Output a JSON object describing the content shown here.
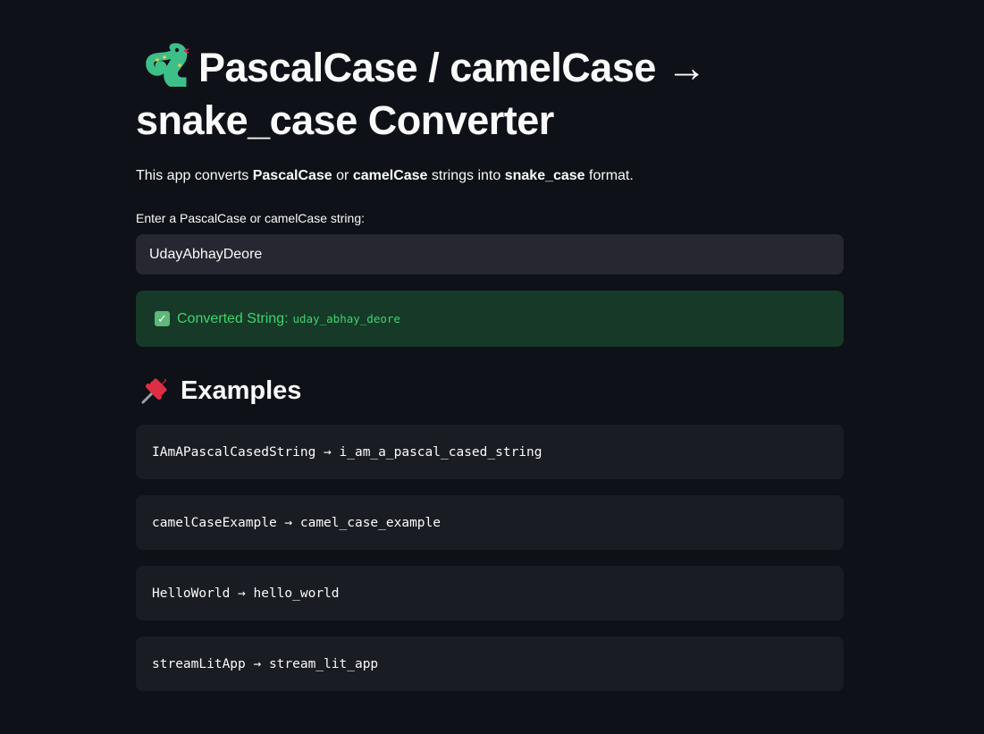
{
  "page": {
    "title_text": "PascalCase / camelCase → snake_case Converter",
    "title_icon": "snake-icon"
  },
  "intro": {
    "prefix": "This app converts ",
    "bold1": "PascalCase",
    "or": " or ",
    "bold2": "camelCase",
    "middle": " strings into ",
    "bold3": "snake_case",
    "suffix": " format."
  },
  "input": {
    "label": "Enter a PascalCase or camelCase string:",
    "value": "UdayAbhayDeore"
  },
  "result": {
    "check_glyph": "✓",
    "label": "Converted String:",
    "value": "uday_abhay_deore"
  },
  "examples": {
    "heading": "Examples",
    "heading_icon": "pushpin-icon",
    "items": [
      "IAmAPascalCasedString → i_am_a_pascal_cased_string",
      "camelCaseExample → camel_case_example",
      "HelloWorld → hello_world",
      "streamLitApp → stream_lit_app"
    ]
  },
  "colors": {
    "background": "#0e1117",
    "input_bg": "#262730",
    "success_bg": "#173928",
    "success_text": "#3dd56d",
    "code_block_bg": "#1a1c24"
  }
}
